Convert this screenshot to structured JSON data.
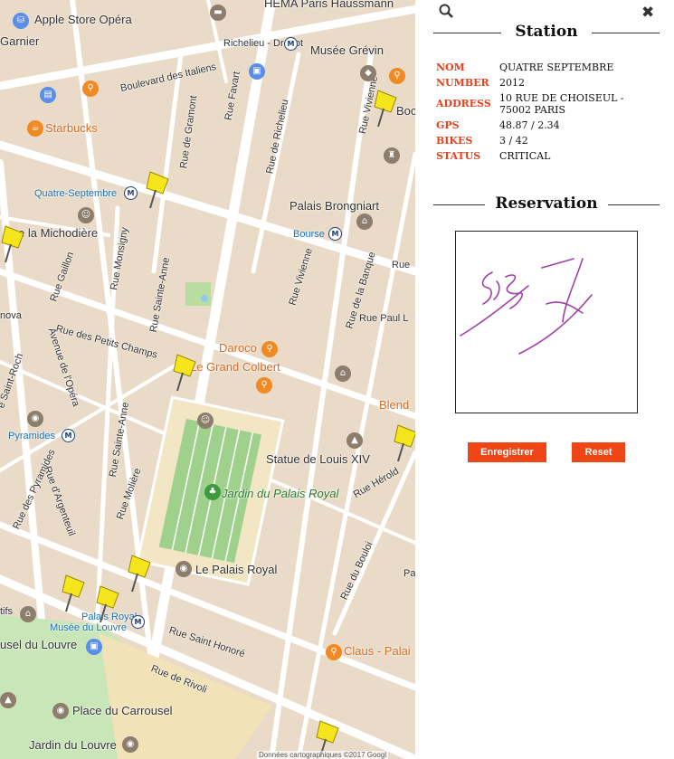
{
  "map": {
    "labels": {
      "apple_store": "Apple Store Opéra",
      "hema": "HEMA Paris Haussmann",
      "garnier": "Garnier",
      "richelieu_drouot": "Richelieu - Drouot",
      "musee_grevin": "Musée Grévin",
      "bd_italiens": "Boulevard des Italiens",
      "rue_vivienne_top": "Rue Vivienne",
      "rue_favart": "Rue Favart",
      "rue_de_gramont": "Rue de Gramont",
      "rue_de_richelieu": "Rue de Richelieu",
      "starbucks": "Starbucks",
      "quatre_septembre": "Quatre-Septembre",
      "bock": "Bock",
      "palais_brongniart": "Palais Brongniart",
      "michodiere": "e la Michodière",
      "bourse": "Bourse",
      "rue_monsigny": "Rue Monsigny",
      "rue_sainte_anne": "Rue Sainte-Anne",
      "rue_gaillon": "Rue Gaillon",
      "rue_vivienne": "Rue Vivienne",
      "rue_de_la_banque": "Rue de la Banque",
      "rue_top_right": "Rue",
      "rue_paul": "Rue Paul L",
      "nova": "nova",
      "petits_champs": "Rue des Petits Champs",
      "avenue_opera": "Avenue de l'Opéra",
      "daroco": "Daroco",
      "grand_colbert": "Le Grand Colbert",
      "saint_roch": "e Saint-Roch",
      "blend": "Blend",
      "pyramides": "Pyramides",
      "rue_sainte_anne_2": "Rue Sainte-Anne",
      "statue": "Statue de Louis XIV",
      "rue_pyramides": "Rue des Pyramides",
      "rue_argenteuil": "Rue d'Argenteuil",
      "rue_moliere": "Rue Molière",
      "jardin": "Jardin du Palais Royal",
      "rue_herold": "Rue Hérold",
      "rue_du_bouloi": "Rue du Bouloi",
      "pa": "Pa",
      "le_palais_royal": "Le Palais Royal",
      "tifs": "tifs",
      "palais_royal_musee": "Palais Royal",
      "musee_du_louvre_metro": "Musée du Louvre",
      "usel_louvre": "usel du Louvre",
      "rue_saint_honore": "Rue Saint Honoré",
      "rue_de_rivoli": "Rue de Rivoli",
      "claus": "Claus - Palai",
      "place_carrousel": "Place du Carrousel",
      "jardin_louvre": "Jardin du Louvre",
      "metro_m": "M"
    },
    "attribution": "Données cartographiques ©2017 Googl"
  },
  "panel": {
    "search_icon": "search-icon",
    "close_icon": "close-icon",
    "station_title": "Station",
    "fields": [
      {
        "key": "NOM",
        "value": "QUATRE SEPTEMBRE"
      },
      {
        "key": "NUMBER",
        "value": "2012"
      },
      {
        "key": "ADDRESS",
        "value": "10 RUE DE CHOISEUL - 75002 PARIS"
      },
      {
        "key": "GPS",
        "value": "48.87 / 2.34"
      },
      {
        "key": "BIKES",
        "value": "3 / 42"
      },
      {
        "key": "STATUS",
        "value": "CRITICAL"
      }
    ],
    "reservation_title": "Reservation",
    "save_label": "Enregistrer",
    "reset_label": "Reset"
  },
  "colors": {
    "accent": "#f04514",
    "field_key": "#e8401c",
    "pin": "#f5e51c",
    "signature": "#a040a8"
  }
}
